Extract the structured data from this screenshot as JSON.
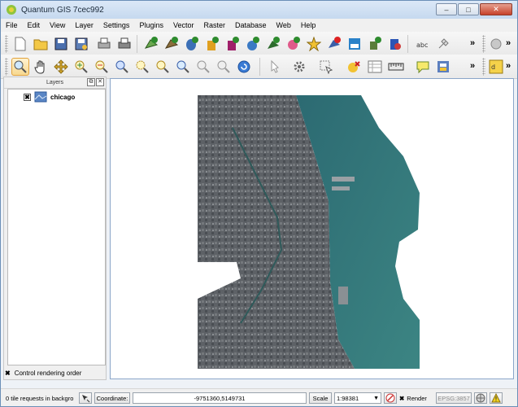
{
  "window": {
    "title": "Quantum GIS 7cec992",
    "min": "–",
    "max": "□",
    "close": "✕"
  },
  "menu": [
    "File",
    "Edit",
    "View",
    "Layer",
    "Settings",
    "Plugins",
    "Vector",
    "Raster",
    "Database",
    "Web",
    "Help"
  ],
  "toolbar": {
    "overflow": "»"
  },
  "layers_panel": {
    "title": "Layers",
    "float_btn": "⧉",
    "close_btn": "✕",
    "layer_name": "chicago",
    "layer_checked": "✖",
    "order_label": "Control rendering order",
    "order_checked": "✖"
  },
  "statusbar": {
    "tiles_text": "0 tile requests in backgro",
    "coordinate_label": "Coordinate:",
    "coordinate_value": "-9751360,5149731",
    "scale_label": "Scale",
    "scale_value": "1:98381",
    "render_label": "Render",
    "render_checked": "✖",
    "crs": "EPSG:3857"
  },
  "colors": {
    "title_bar": "#c6d9ef",
    "map_border": "#8ba6c9",
    "lake": "#2f6f76",
    "city": "#5a5e63",
    "active_tool": "#f7d88f"
  }
}
